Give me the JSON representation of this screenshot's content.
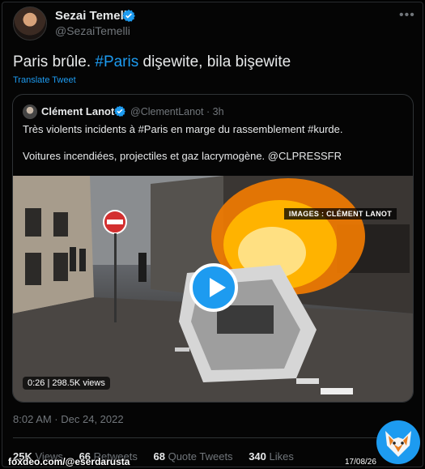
{
  "tweet": {
    "author_name": "Sezai Temelli",
    "author_handle": "@SezaiTemelli",
    "text_part1": "Paris brûle. ",
    "text_hashtag": "#Paris",
    "text_part2": " dişewite, bila bişewite",
    "translate_label": "Translate Tweet",
    "timestamp": "8:02 AM · Dec 24, 2022"
  },
  "quote": {
    "author_name": "Clément Lanot",
    "meta": "@ClementLanot · 3h",
    "line1": "Très violents incidents à #Paris en marge du rassemblement #kurde.",
    "line2": "Voitures incendiées, projectiles et gaz lacrymogène. @CLPRESSFR",
    "media_credit": "IMAGES : CLÉMENT LANOT",
    "video_duration": "0:26",
    "video_views": "298.5K views"
  },
  "stats": {
    "views_count": "25K",
    "views_label": "Views",
    "retweets_count": "66",
    "retweets_label": "Retweets",
    "quotes_count": "68",
    "quotes_label": "Quote Tweets",
    "likes_count": "340",
    "likes_label": "Likes"
  },
  "watermark": {
    "text": "foxdeo.com/@eserdarusta",
    "date": "17/08/26"
  },
  "colors": {
    "accent": "#1d9bf0",
    "text": "#e7e9ea",
    "muted": "#71767b",
    "background": "#000000"
  },
  "icons": [
    "verified-badge-icon",
    "more-options-icon",
    "play-icon",
    "fox-logo-icon"
  ]
}
